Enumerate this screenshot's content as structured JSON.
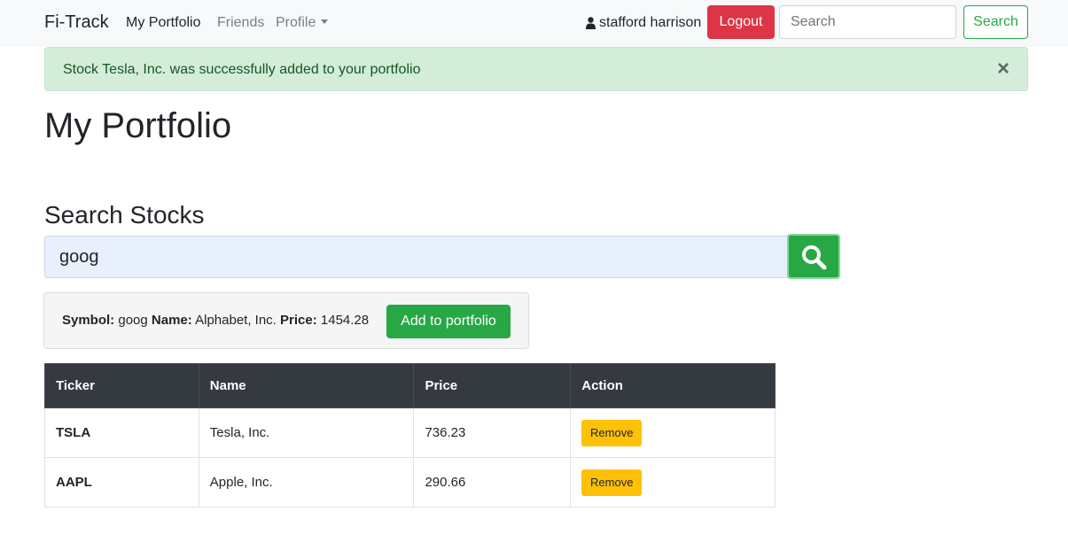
{
  "nav": {
    "brand": "Fi-Track",
    "links": [
      {
        "label": "My Portfolio"
      },
      {
        "label": "Friends"
      },
      {
        "label": "Profile"
      }
    ],
    "user_name": "stafford harrison",
    "logout_label": "Logout",
    "search_placeholder": "Search",
    "search_button": "Search"
  },
  "alert": {
    "message": "Stock Tesla, Inc. was successfully added to your portfolio",
    "close_glyph": "×"
  },
  "page_title": "My Portfolio",
  "search": {
    "heading": "Search Stocks",
    "value": "goog"
  },
  "result": {
    "symbol_label": "Symbol:",
    "symbol": "goog",
    "name_label": "Name:",
    "name": "Alphabet, Inc.",
    "price_label": "Price:",
    "price": "1454.28",
    "add_label": "Add to portfolio"
  },
  "table": {
    "headers": [
      "Ticker",
      "Name",
      "Price",
      "Action"
    ],
    "rows": [
      {
        "ticker": "TSLA",
        "name": "Tesla, Inc.",
        "price": "736.23",
        "action": "Remove"
      },
      {
        "ticker": "AAPL",
        "name": "Apple, Inc.",
        "price": "290.66",
        "action": "Remove"
      }
    ]
  },
  "colors": {
    "danger": "#dc3545",
    "success": "#28a745",
    "warning": "#ffc107",
    "dark": "#343a40",
    "alert_bg": "#d4edda"
  }
}
